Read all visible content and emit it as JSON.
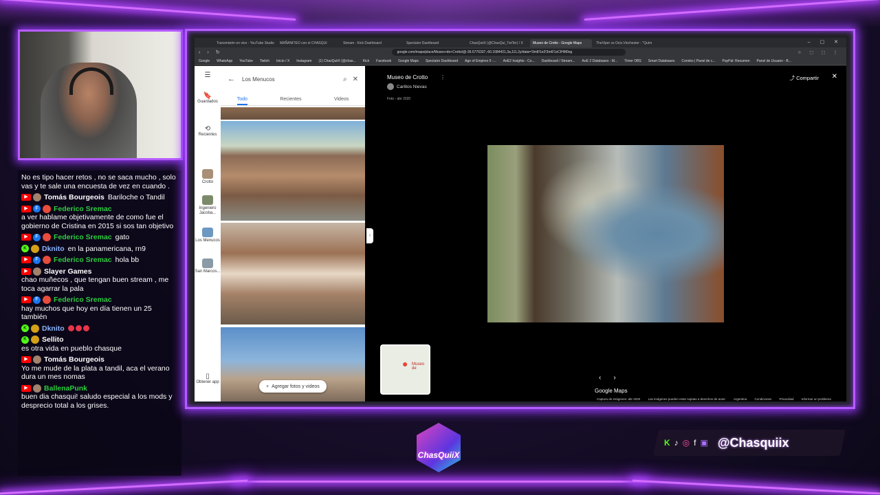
{
  "browser": {
    "tabs": [
      "Transmisión en vivo - YouTube Studio",
      "MAÑANITEO con el CHASQUI",
      "Stream - Kick Dashboard",
      "Spectator Dashboard",
      "ChasQuiiX (@ChasQui_TwiTer) / X",
      "Museo de Crotto - Google Maps",
      "TheViper vs Ocis.Vinchester - \"Quím"
    ],
    "active_tab_index": 5,
    "url": "google.com/maps/place/Museo+de+Crotto/@-36.5776337,-60.1684421,3a,111.2y/data=!3m8!1e2!3m6!1sCIHM0og",
    "bookmarks": [
      "Google",
      "WhatsApp",
      "YouTube",
      "Twitch",
      "Inicio / X",
      "Instagram",
      "(1) ChasQuiiX (@chas...",
      "Kick",
      "Facebook",
      "Google Maps",
      "Spectator Dashboard",
      "Age of Empires II -...",
      "AoE2 Insights - Co...",
      "Dashboard / Stream...",
      "AoE 2 Databases - M...",
      "Timer OBS",
      "Smart Databases",
      "Coneko | Panel de c...",
      "PayPal: Resumen",
      "Panel de Usuario - B..."
    ]
  },
  "maps": {
    "rail": {
      "saved": "Guardados",
      "recent": "Recientes",
      "places": [
        "Crotto",
        "Ingeniero Jacoba...",
        "Los Menucos",
        "San Marcos..."
      ],
      "get_app": "Obtener app"
    },
    "search_value": "Los Menucos",
    "tabs": [
      "Todo",
      "Recientes",
      "Videos"
    ],
    "add_photos": "Agregar fotos y videos",
    "viewer": {
      "title": "Museo de Crotto",
      "author": "Carlitos Nievas",
      "date": "Foto - abr 2020",
      "share": "Compartir",
      "minimap_label": "Museo de",
      "logo": "Google Maps",
      "footer": [
        "Captura de imágenes: abr 2020",
        "Las imágenes pueden estar sujetas a derechos de autor.",
        "Argentina",
        "Condiciones",
        "Privacidad",
        "Informar un problema"
      ]
    }
  },
  "chat": {
    "messages": [
      {
        "platform": "",
        "user": "",
        "text": "No es tipo hacer retos , no se saca mucho , solo vas y te sale una encuesta de vez en cuando ."
      },
      {
        "platform": "yt",
        "user": "Tomás Bourgeois",
        "user_color": "#ffffff",
        "text": "Bariloche o Tandil"
      },
      {
        "platform": "fb",
        "user": "Federico Sremac",
        "user_color": "#2ecc40",
        "text": "a ver hablame objetivamente de como fue el gobierno de Cristina en 2015 si sos tan objetivo"
      },
      {
        "platform": "fb",
        "user": "Federico Sremac",
        "user_color": "#2ecc40",
        "text": "gato"
      },
      {
        "platform": "kick",
        "user": "Dknito",
        "user_color": "#8ab4ff",
        "text": "en la panamericana, rn9"
      },
      {
        "platform": "fb",
        "user": "Federico Sremac",
        "user_color": "#2ecc40",
        "text": "hola bb"
      },
      {
        "platform": "yt",
        "user": "Slayer Games",
        "user_color": "#ffffff",
        "text": "chao muñecos , que tengan buen stream , me toca agarrar la pala"
      },
      {
        "platform": "fb",
        "user": "Federico Sremac",
        "user_color": "#2ecc40",
        "text": "hay muchos que hoy en día tienen un 25 también"
      },
      {
        "platform": "kick",
        "user": "Dknito",
        "user_color": "#8ab4ff",
        "text": ""
      },
      {
        "platform": "kick",
        "user": "Sellito",
        "user_color": "#ffffff",
        "text": "es otra vida en pueblo chasque"
      },
      {
        "platform": "yt",
        "user": "Tomás Bourgeois",
        "user_color": "#ffffff",
        "text": "Yo me mude de la plata a tandil, aca el verano dura un mes nomas"
      },
      {
        "platform": "yt",
        "user": "BallenaPunk",
        "user_color": "#2ecc40",
        "text": "buen dia chasqui! saludo especial a los mods y desprecio total a los grises."
      }
    ]
  },
  "branding": {
    "logo_text": "ChasQuiiX",
    "handle": "@Chasquiix"
  },
  "colors": {
    "neon": "#b65cff",
    "maps_blue": "#1a73e8"
  }
}
